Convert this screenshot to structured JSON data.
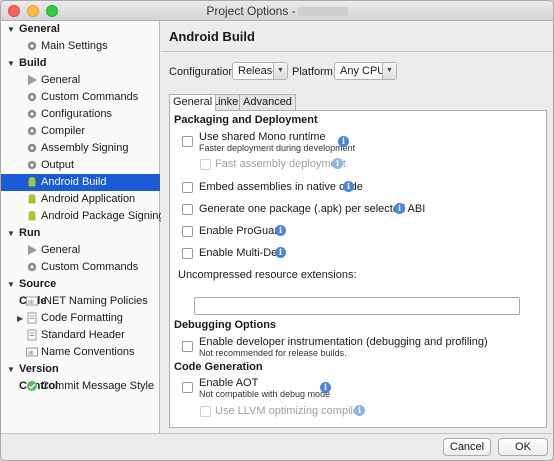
{
  "window": {
    "title": "Project Options -"
  },
  "sidebar": {
    "sections": [
      {
        "label": "General",
        "items": [
          {
            "label": "Main Settings",
            "icon": "gear-icon"
          }
        ]
      },
      {
        "label": "Build",
        "items": [
          {
            "label": "General",
            "icon": "play-icon"
          },
          {
            "label": "Custom Commands",
            "icon": "gear-icon"
          },
          {
            "label": "Configurations",
            "icon": "gear-icon"
          },
          {
            "label": "Compiler",
            "icon": "gear-icon"
          },
          {
            "label": "Assembly Signing",
            "icon": "gear-icon"
          },
          {
            "label": "Output",
            "icon": "gear-icon"
          },
          {
            "label": "Android Build",
            "icon": "android-icon"
          },
          {
            "label": "Android Application",
            "icon": "android-icon"
          },
          {
            "label": "Android Package Signing",
            "icon": "android-icon"
          }
        ]
      },
      {
        "label": "Run",
        "items": [
          {
            "label": "General",
            "icon": "play-icon"
          },
          {
            "label": "Custom Commands",
            "icon": "gear-icon"
          }
        ]
      },
      {
        "label": "Source Code",
        "items": [
          {
            "label": ".NET Naming Policies",
            "icon": "ab-icon"
          },
          {
            "label": "Code Formatting",
            "icon": "document-icon"
          },
          {
            "label": "Standard Header",
            "icon": "document-icon"
          },
          {
            "label": "Name Conventions",
            "icon": "ab-icon"
          }
        ]
      },
      {
        "label": "Version Control",
        "items": [
          {
            "label": "Commit Message Style",
            "icon": "check-circle-icon"
          }
        ]
      }
    ]
  },
  "main": {
    "title": "Android Build",
    "configuration_label": "Configuration:",
    "configuration_value": "Release",
    "platform_label": "Platform:",
    "platform_value": "Any CPU",
    "tabs": [
      "General",
      "Linker",
      "Advanced"
    ],
    "packaging": {
      "heading": "Packaging and Deployment",
      "shared_runtime": "Use shared Mono runtime",
      "shared_runtime_sub": "Faster deployment during development",
      "fast_deploy": "Fast assembly deployment",
      "embed": "Embed assemblies in native code",
      "per_abi": "Generate one package (.apk) per selected ABI",
      "proguard": "Enable ProGuard",
      "multidex": "Enable Multi-Dex",
      "uncompressed_label": "Uncompressed resource extensions:",
      "uncompressed_value": ""
    },
    "debugging": {
      "heading": "Debugging Options",
      "instrumentation": "Enable developer instrumentation (debugging and profiling)",
      "instrumentation_sub": "Not recommended for release builds."
    },
    "codegen": {
      "heading": "Code Generation",
      "aot": "Enable AOT",
      "aot_sub": "Not compatible with debug mode",
      "llvm": "Use LLVM optimizing compiler"
    },
    "info_glyph": "i"
  },
  "footer": {
    "cancel": "Cancel",
    "ok": "OK"
  },
  "colors": {
    "selection": "#1b5bd6",
    "info": "#4a85d8"
  }
}
